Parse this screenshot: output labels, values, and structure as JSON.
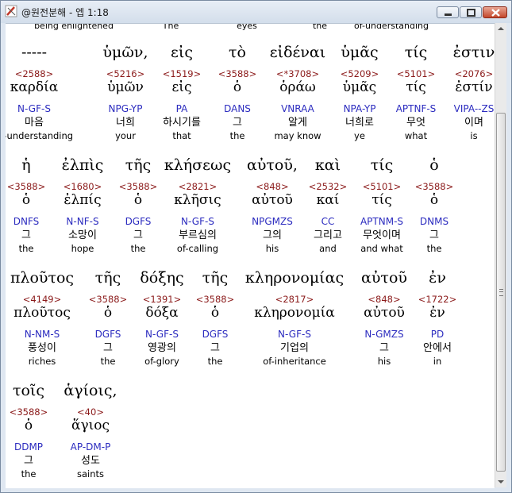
{
  "window": {
    "title": "@원전분해 - 엡 1:18",
    "app_icon": "pencil-ruler-icon",
    "buttons": {
      "minimize": "minimize-icon",
      "maximize": "maximize-icon",
      "close": "close-icon"
    }
  },
  "cut_row": [
    "being enlightened",
    "The",
    "eyes",
    "the",
    "of-understanding"
  ],
  "rows": [
    [
      {
        "greek": "-----",
        "strong": "<2588>",
        "lex": "καρδία",
        "morph": "N-GF-S",
        "kor": "마음",
        "eng": "of-understanding"
      },
      {
        "greek": "ὑμῶν,",
        "strong": "<5216>",
        "lex": "ὑμῶν",
        "morph": "NPG-YP",
        "kor": "너희",
        "eng": "your"
      },
      {
        "greek": "εἰς",
        "strong": "<1519>",
        "lex": "εἰς",
        "morph": "PA",
        "kor": "하시기를",
        "eng": "that"
      },
      {
        "greek": "τὸ",
        "strong": "<3588>",
        "lex": "ὁ",
        "morph": "DANS",
        "kor": "그",
        "eng": "the"
      },
      {
        "greek": "εἰδέναι",
        "strong": "<*3708>",
        "lex": "ὁράω",
        "morph": "VNRAA",
        "kor": "알게",
        "eng": "may know"
      },
      {
        "greek": "ὑμᾶς",
        "strong": "<5209>",
        "lex": "ὑμᾶς",
        "morph": "NPA-YP",
        "kor": "너희로",
        "eng": "ye"
      },
      {
        "greek": "τίς",
        "strong": "<5101>",
        "lex": "τίς",
        "morph": "APTNF-S",
        "kor": "무엇",
        "eng": "what"
      },
      {
        "greek": "ἐστιν",
        "strong": "<2076>",
        "lex": "ἐστίν",
        "morph": "VIPA--ZS",
        "kor": "이며",
        "eng": "is"
      }
    ],
    [
      {
        "greek": "ἡ",
        "strong": "<3588>",
        "lex": "ὁ",
        "morph": "DNFS",
        "kor": "그",
        "eng": "the"
      },
      {
        "greek": "ἐλπὶς",
        "strong": "<1680>",
        "lex": "ἐλπίς",
        "morph": "N-NF-S",
        "kor": "소망이",
        "eng": "hope"
      },
      {
        "greek": "τῆς",
        "strong": "<3588>",
        "lex": "ὁ",
        "morph": "DGFS",
        "kor": "그",
        "eng": "the"
      },
      {
        "greek": "κλήσεως",
        "strong": "<2821>",
        "lex": "κλῆσις",
        "morph": "N-GF-S",
        "kor": "부르심의",
        "eng": "of-calling"
      },
      {
        "greek": "αὐτοῦ,",
        "strong": "<848>",
        "lex": "αὐτοῦ",
        "morph": "NPGMZS",
        "kor": "그의",
        "eng": "his"
      },
      {
        "greek": "καὶ",
        "strong": "<2532>",
        "lex": "καί",
        "morph": "CC",
        "kor": "그리고",
        "eng": "and"
      },
      {
        "greek": "τίς",
        "strong": "<5101>",
        "lex": "τίς",
        "morph": "APTNM-S",
        "kor": "무엇이며",
        "eng": "and what"
      },
      {
        "greek": "ὁ",
        "strong": "<3588>",
        "lex": "ὁ",
        "morph": "DNMS",
        "kor": "그",
        "eng": "the"
      }
    ],
    [
      {
        "greek": "πλοῦτος",
        "strong": "<4149>",
        "lex": "πλοῦτος",
        "morph": "N-NM-S",
        "kor": "풍성이",
        "eng": "riches"
      },
      {
        "greek": "τῆς",
        "strong": "<3588>",
        "lex": "ὁ",
        "morph": "DGFS",
        "kor": "그",
        "eng": "the"
      },
      {
        "greek": "δόξης",
        "strong": "<1391>",
        "lex": "δόξα",
        "morph": "N-GF-S",
        "kor": "영광의",
        "eng": "of-glory"
      },
      {
        "greek": "τῆς",
        "strong": "<3588>",
        "lex": "ὁ",
        "morph": "DGFS",
        "kor": "그",
        "eng": "the"
      },
      {
        "greek": "κληρονομίας",
        "strong": "<2817>",
        "lex": "κληρονομία",
        "morph": "N-GF-S",
        "kor": "기업의",
        "eng": "of-inheritance"
      },
      {
        "greek": "αὐτοῦ",
        "strong": "<848>",
        "lex": "αὐτοῦ",
        "morph": "N-GMZS",
        "kor": "그",
        "eng": "his"
      },
      {
        "greek": "ἐν",
        "strong": "<1722>",
        "lex": "ἐν",
        "morph": "PD",
        "kor": "안에서",
        "eng": "in"
      }
    ],
    [
      {
        "greek": "τοῖς",
        "strong": "<3588>",
        "lex": "ὁ",
        "morph": "DDMP",
        "kor": "그",
        "eng": "the"
      },
      {
        "greek": "ἁγίοις,",
        "strong": "<40>",
        "lex": "ἅγιος",
        "morph": "AP-DM-P",
        "kor": "성도",
        "eng": "saints"
      }
    ]
  ]
}
